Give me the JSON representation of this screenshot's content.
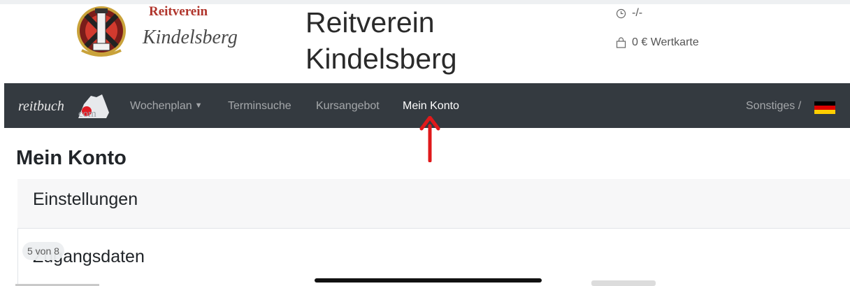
{
  "header": {
    "logo_text_top": "Reitverein",
    "logo_text_script": "Kindelsberg",
    "title_line1": "Reitverein",
    "title_line2": "Kindelsberg",
    "time_icon": "clock-icon",
    "time_value": "-/-",
    "card_icon": "shopping-bag-icon",
    "card_value": "0 € Wertkarte"
  },
  "navbar": {
    "brand_text": "reitbuch",
    "brand_suffix": "com",
    "items": [
      {
        "label": "Wochenplan",
        "dropdown": true
      },
      {
        "label": "Terminsuche",
        "dropdown": false
      },
      {
        "label": "Kursangebot",
        "dropdown": false
      },
      {
        "label": "Mein Konto",
        "dropdown": false,
        "active": true
      }
    ],
    "right_label": "Sonstiges /",
    "flag_icon": "german-flag-icon"
  },
  "content": {
    "page_title": "Mein Konto",
    "card_title": "Einstellungen",
    "section_title": "Zugangsdaten"
  },
  "overlay": {
    "page_indicator": "5 von 8"
  },
  "colors": {
    "navbar_bg": "#343a40",
    "arrow": "#e0191b",
    "logo_red": "#b0352c"
  }
}
